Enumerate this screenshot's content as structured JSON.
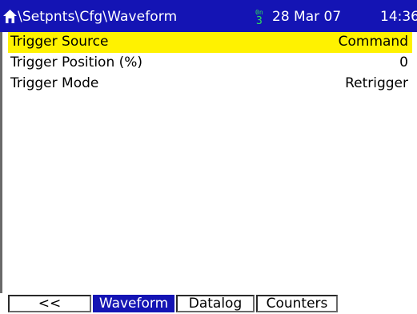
{
  "header": {
    "path": "\\Setpnts\\Cfg\\Waveform",
    "date": "28 Mar 07",
    "time": "14:36",
    "home_icon": "home-icon",
    "comm_icon": "comm-icon",
    "colors": {
      "bar": "#1414b4",
      "comm": "#2ee05a"
    }
  },
  "settings": [
    {
      "label": "Trigger Source",
      "value": "Command",
      "selected": true
    },
    {
      "label": "Trigger Position (%)",
      "value": "0",
      "selected": false
    },
    {
      "label": "Trigger Mode",
      "value": "Retrigger",
      "selected": false
    }
  ],
  "softkeys": [
    {
      "label": "<<",
      "active": false
    },
    {
      "label": "Waveform",
      "active": true
    },
    {
      "label": "Datalog",
      "active": false
    },
    {
      "label": "Counters",
      "active": false
    }
  ],
  "colors": {
    "selection": "#fff200",
    "active_key": "#1414b4"
  }
}
